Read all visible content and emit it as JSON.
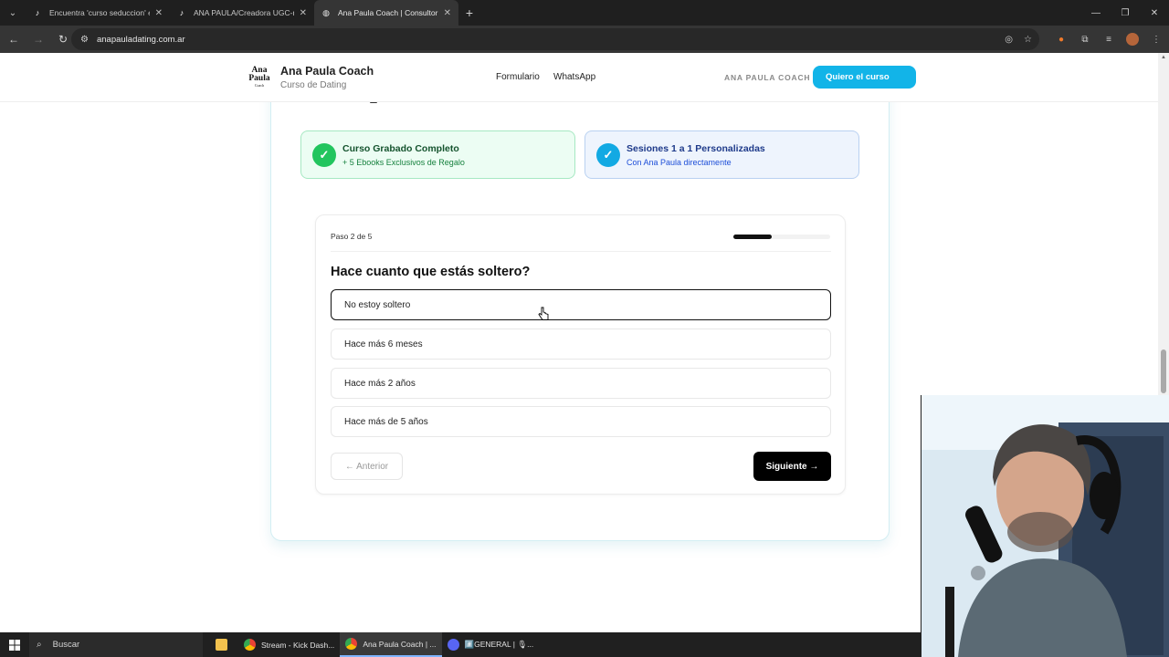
{
  "browser": {
    "tabs": [
      {
        "title": "Encuentra 'curso seduccion' en",
        "icon": "tiktok-icon",
        "active": false
      },
      {
        "title": "ANA PAULA/Creadora UGC-mo",
        "icon": "tiktok-icon",
        "active": false
      },
      {
        "title": "Ana Paula Coach | Consultoría",
        "icon": "globe-icon",
        "active": true
      }
    ],
    "url": "anapauladating.com.ar"
  },
  "site": {
    "logo_text": "Ana Paula",
    "logo_sub": "Coach",
    "brand_name": "Ana Paula Coach",
    "brand_subtitle": "Curso de Dating",
    "nav": [
      "Formulario",
      "WhatsApp"
    ],
    "nav_brand": "ANA PAULA COACH",
    "cta_label": "Quiero el curso"
  },
  "features": [
    {
      "title": "Curso Grabado Completo",
      "subtitle": "+ 5 Ebooks Exclusivos de Regalo",
      "color": "#22c55e"
    },
    {
      "title": "Sesiones 1 a 1 Personalizadas",
      "subtitle": "Con Ana Paula directamente",
      "color": "#12a9e3"
    }
  ],
  "quiz": {
    "step_label": "Paso 2 de 5",
    "progress": 0.4,
    "question": "Hace cuanto que estás soltero?",
    "options": [
      "No estoy soltero",
      "Hace más 6 meses",
      "Hace más 2 años",
      "Hace más de 5 años"
    ],
    "selected_index": 0,
    "prev_label": "← Anterior",
    "next_label": "Siguiente →"
  },
  "taskbar": {
    "search_placeholder": "Buscar",
    "items": [
      {
        "label": "Stream - Kick Dash...",
        "icon": "chrome-icon"
      },
      {
        "label": "Ana Paula Coach | ...",
        "icon": "chrome-icon",
        "active": true
      },
      {
        "label": "#️⃣GENERAL | 🎙...",
        "icon": "discord-icon"
      }
    ]
  },
  "accent_color": "#12b4e8"
}
